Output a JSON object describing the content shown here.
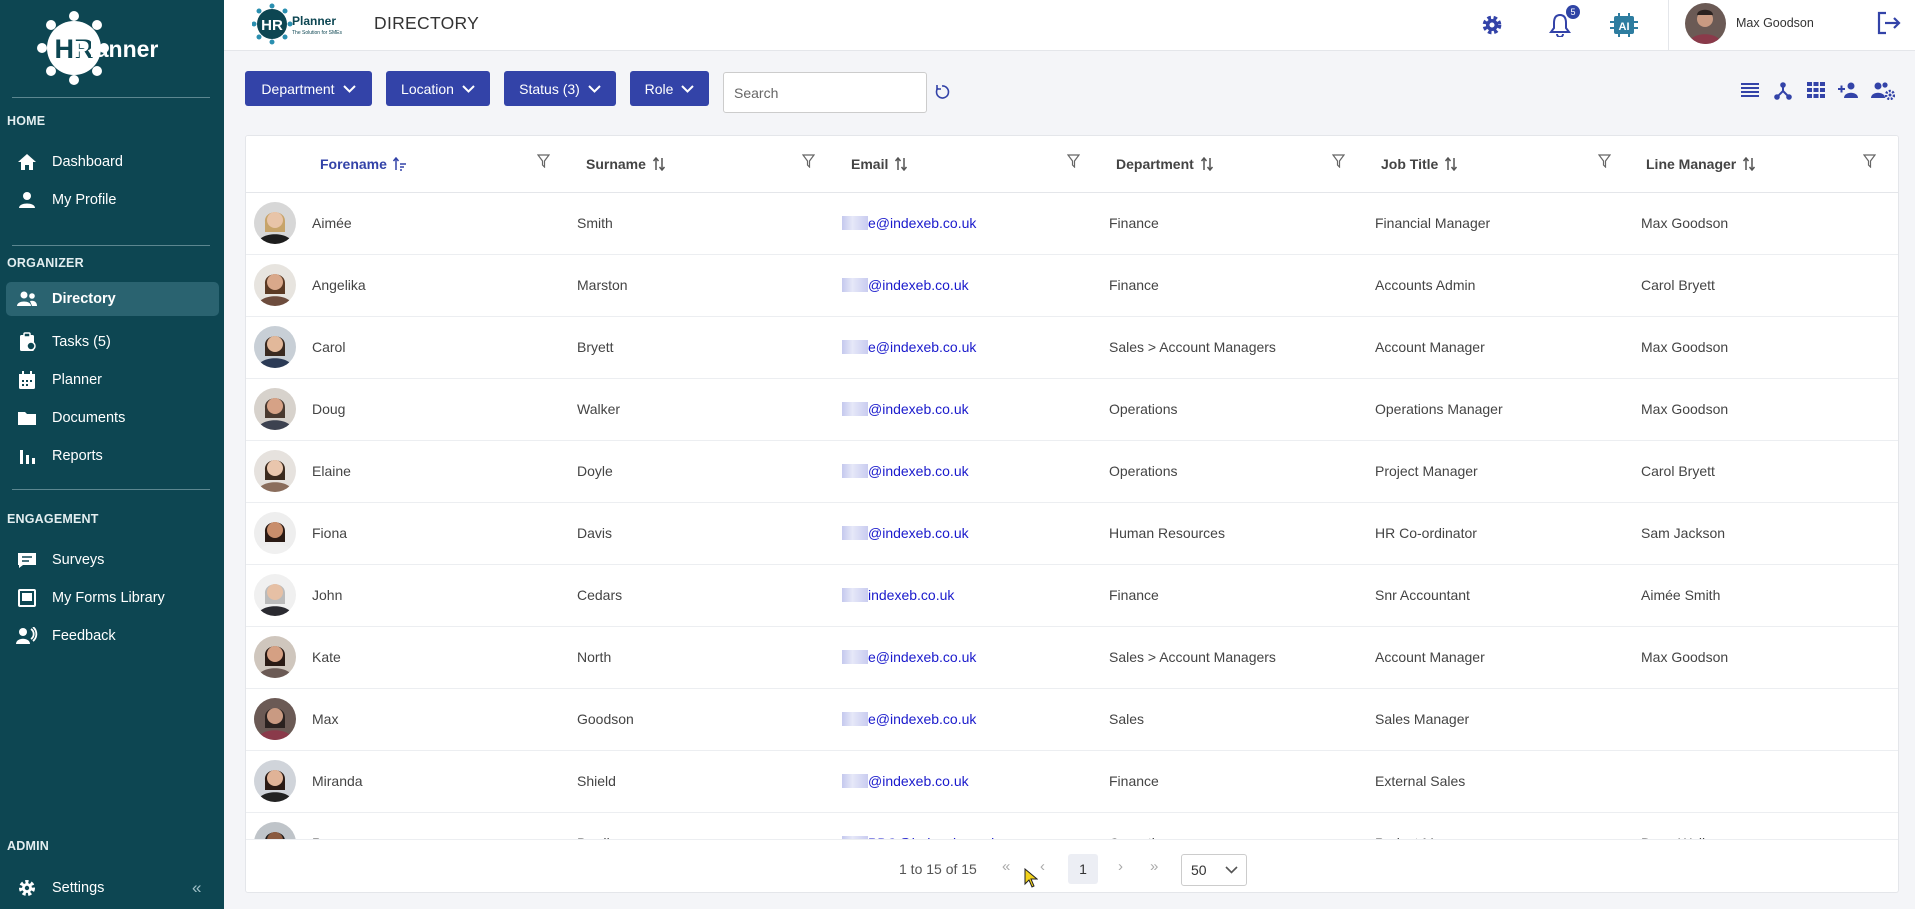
{
  "sidebar": {
    "logo_text": "Planner",
    "logo_letters": "HR",
    "sections": {
      "home": "HOME",
      "organizer": "ORGANIZER",
      "engagement": "ENGAGEMENT",
      "admin": "ADMIN"
    },
    "items": [
      {
        "label": "Dashboard",
        "icon": "home-icon"
      },
      {
        "label": "My Profile",
        "icon": "person-icon"
      },
      {
        "label": "Directory",
        "icon": "people-icon",
        "active": true
      },
      {
        "label": "Tasks (5)",
        "icon": "clipboard-icon"
      },
      {
        "label": "Planner",
        "icon": "calendar-icon"
      },
      {
        "label": "Documents",
        "icon": "folder-icon"
      },
      {
        "label": "Reports",
        "icon": "bar-chart-icon"
      },
      {
        "label": "Surveys",
        "icon": "survey-icon"
      },
      {
        "label": "My Forms Library",
        "icon": "book-icon"
      },
      {
        "label": "Feedback",
        "icon": "feedback-icon"
      },
      {
        "label": "Settings",
        "icon": "gear-icon"
      }
    ],
    "collapse_glyph": "«"
  },
  "header": {
    "title": "DIRECTORY",
    "logo_small_letters": "HR",
    "logo_small_text": "Planner",
    "logo_small_tagline": "The Solution for SMEs",
    "notification_count": "5",
    "ai_label": "AI",
    "user_name": "Max Goodson"
  },
  "filters": {
    "buttons": [
      "Department",
      "Location",
      "Status (3)",
      "Role"
    ],
    "search_placeholder": "Search"
  },
  "table": {
    "columns": [
      "Forename",
      "Surname",
      "Email",
      "Department",
      "Job Title",
      "Line Manager"
    ],
    "rows": [
      {
        "forename": "Aimée",
        "surname": "Smith",
        "email": "e@indexeb.co.uk",
        "department": "Finance",
        "job_title": "Financial Manager",
        "line_manager": "Max Goodson"
      },
      {
        "forename": "Angelika",
        "surname": "Marston",
        "email": "@indexeb.co.uk",
        "department": "Finance",
        "job_title": "Accounts Admin",
        "line_manager": "Carol Bryett"
      },
      {
        "forename": "Carol",
        "surname": "Bryett",
        "email": "e@indexeb.co.uk",
        "department": "Sales > Account Managers",
        "job_title": "Account Manager",
        "line_manager": "Max Goodson"
      },
      {
        "forename": "Doug",
        "surname": "Walker",
        "email": "@indexeb.co.uk",
        "department": "Operations",
        "job_title": "Operations Manager",
        "line_manager": "Max Goodson"
      },
      {
        "forename": "Elaine",
        "surname": "Doyle",
        "email": "@indexeb.co.uk",
        "department": "Operations",
        "job_title": "Project Manager",
        "line_manager": "Carol Bryett"
      },
      {
        "forename": "Fiona",
        "surname": "Davis",
        "email": "@indexeb.co.uk",
        "department": "Human Resources",
        "job_title": "HR Co-ordinator",
        "line_manager": "Sam Jackson"
      },
      {
        "forename": "John",
        "surname": "Cedars",
        "email": "indexeb.co.uk",
        "department": "Finance",
        "job_title": "Snr Accountant",
        "line_manager": "Aimée Smith"
      },
      {
        "forename": "Kate",
        "surname": "North",
        "email": "e@indexeb.co.uk",
        "department": "Sales > Account Managers",
        "job_title": "Account Manager",
        "line_manager": "Max Goodson"
      },
      {
        "forename": "Max",
        "surname": "Goodson",
        "email": "e@indexeb.co.uk",
        "department": "Sales",
        "job_title": "Sales Manager",
        "line_manager": ""
      },
      {
        "forename": "Miranda",
        "surname": "Shield",
        "email": "@indexeb.co.uk",
        "department": "Finance",
        "job_title": "External Sales",
        "line_manager": ""
      },
      {
        "forename": "P",
        "surname": "Bradl",
        "email": "PBO@indexeb.co.uk",
        "department": "Operations",
        "job_title": "Project Manager",
        "line_manager": "Doug Walker"
      }
    ]
  },
  "pagination": {
    "summary": "1 to 15 of 15",
    "current_page": "1",
    "page_size": "50",
    "first_glyph": "«",
    "prev_glyph": "‹",
    "next_glyph": "›",
    "last_glyph": "»"
  },
  "colors": {
    "sidebar_bg": "#0d4652",
    "accent": "#3343a8",
    "link": "#1a1acc"
  }
}
